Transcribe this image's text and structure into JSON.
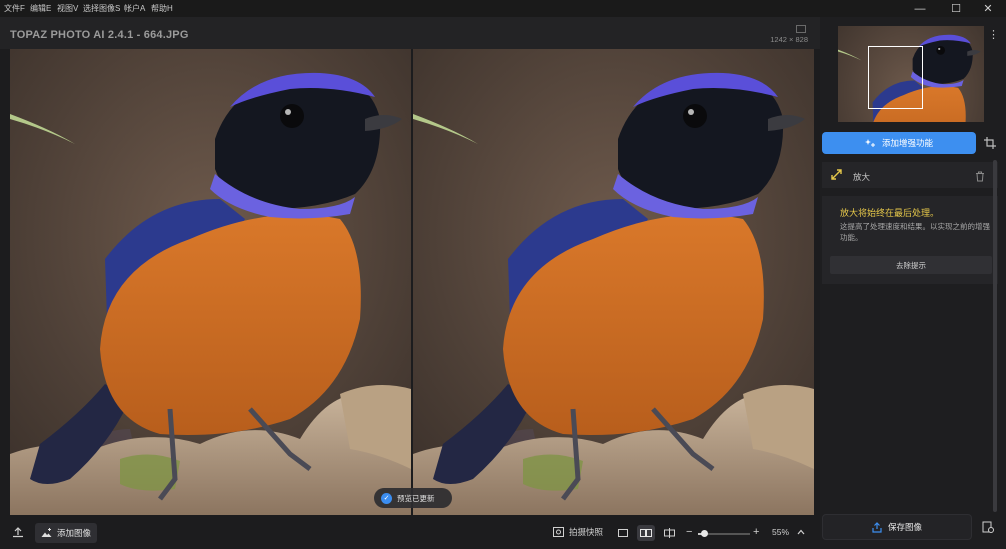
{
  "menu": [
    {
      "label": "文件F"
    },
    {
      "label": "编辑E"
    },
    {
      "label": "视图V"
    },
    {
      "label": "选择图像S"
    },
    {
      "label": "帐户A"
    },
    {
      "label": "帮助H"
    }
  ],
  "window": {
    "minimize": "—",
    "maximize": "☐",
    "close": "✕"
  },
  "header": {
    "title": "TOPAZ PHOTO AI 2.4.1 - 664.JPG",
    "dimensions": "1242 × 828"
  },
  "preview": {
    "status_toast": "预览已更新"
  },
  "bottom": {
    "add_image": "添加图像",
    "capture_snapshot": "拍摄快照",
    "zoom": "55%",
    "zoom_fraction": 0.12
  },
  "side": {
    "add_enhancement": "添加增强功能",
    "enhancement_item": "放大",
    "info_title": "放大将始终在最后处理。",
    "info_body": "这提高了处理速度和结果。以实现之前的增强功能。",
    "dismiss": "去除提示",
    "save_image": "保存图像"
  },
  "colors": {
    "accent": "#3d8ff0",
    "warning_text": "#e6c84a",
    "background": "#1c1c1e"
  }
}
